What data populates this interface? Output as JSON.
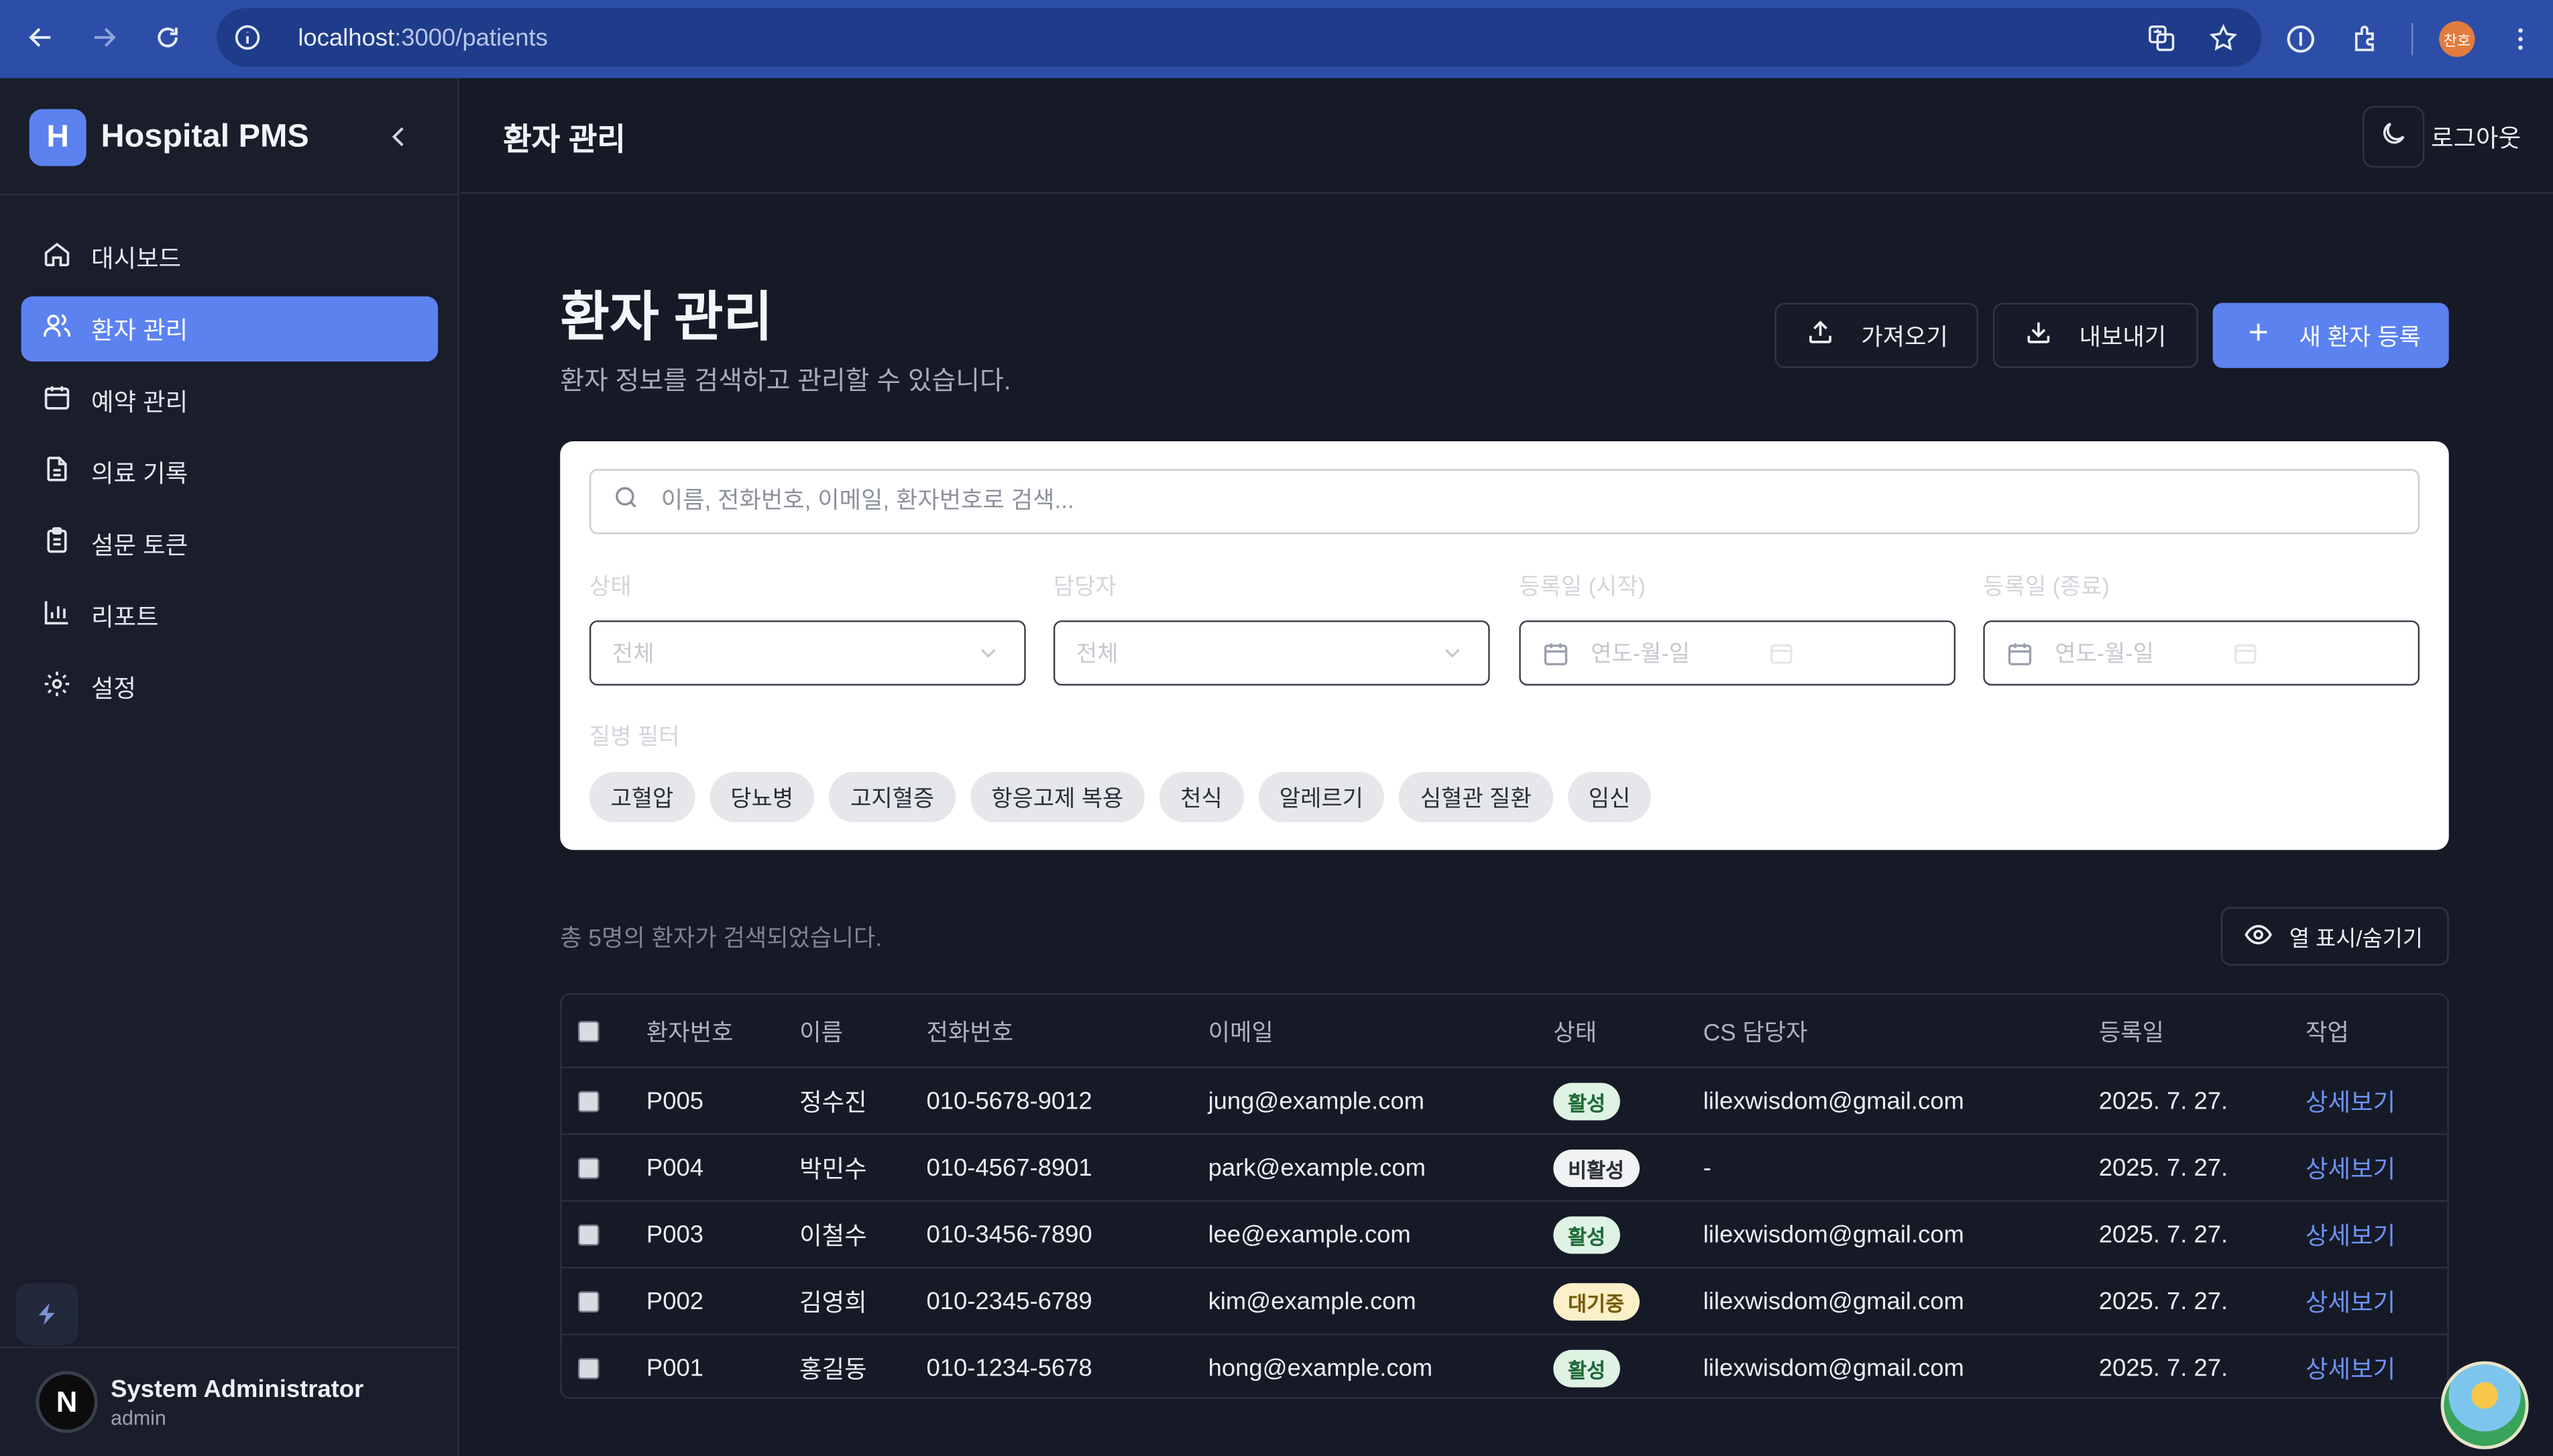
{
  "browser": {
    "url_host": "localhost",
    "url_path": ":3000/patients",
    "profile_initials": "찬호"
  },
  "sidebar": {
    "brand_letter": "H",
    "brand_name": "Hospital PMS",
    "items": [
      {
        "label": "대시보드",
        "icon": "home-icon"
      },
      {
        "label": "환자 관리",
        "icon": "users-icon",
        "active": true
      },
      {
        "label": "예약 관리",
        "icon": "calendar-icon"
      },
      {
        "label": "의료 기록",
        "icon": "file-text-icon"
      },
      {
        "label": "설문 토큰",
        "icon": "clipboard-icon"
      },
      {
        "label": "리포트",
        "icon": "bar-chart-icon"
      },
      {
        "label": "설정",
        "icon": "gear-icon"
      }
    ],
    "user": {
      "initial": "N",
      "name": "System Administrator",
      "role": "admin"
    }
  },
  "topbar": {
    "title": "환자 관리",
    "logout": "로그아웃"
  },
  "page": {
    "title": "환자 관리",
    "subtitle": "환자 정보를 검색하고 관리할 수 있습니다.",
    "import_label": "가져오기",
    "export_label": "내보내기",
    "new_label": "새 환자 등록"
  },
  "filters": {
    "search_placeholder": "이름, 전화번호, 이메일, 환자번호로 검색...",
    "status_label": "상태",
    "status_value": "전체",
    "manager_label": "담당자",
    "manager_value": "전체",
    "date_start_label": "등록일 (시작)",
    "date_end_label": "등록일 (종료)",
    "date_placeholder": "연도-월-일",
    "disease_label": "질병 필터",
    "diseases": [
      "고혈압",
      "당뇨병",
      "고지혈증",
      "항응고제 복용",
      "천식",
      "알레르기",
      "심혈관 질환",
      "임신"
    ]
  },
  "results": {
    "count_text": "총 5명의 환자가 검색되었습니다.",
    "columns_button": "열 표시/숨기기"
  },
  "table": {
    "headers": [
      "환자번호",
      "이름",
      "전화번호",
      "이메일",
      "상태",
      "CS 담당자",
      "등록일",
      "작업"
    ],
    "rows": [
      {
        "id": "P005",
        "name": "정수진",
        "phone": "010-5678-9012",
        "email": "jung@example.com",
        "status": "활성",
        "status_type": "active",
        "cs": "lilexwisdom@gmail.com",
        "date": "2025. 7. 27.",
        "action": "상세보기"
      },
      {
        "id": "P004",
        "name": "박민수",
        "phone": "010-4567-8901",
        "email": "park@example.com",
        "status": "비활성",
        "status_type": "inactive",
        "cs": "-",
        "date": "2025. 7. 27.",
        "action": "상세보기"
      },
      {
        "id": "P003",
        "name": "이철수",
        "phone": "010-3456-7890",
        "email": "lee@example.com",
        "status": "활성",
        "status_type": "active",
        "cs": "lilexwisdom@gmail.com",
        "date": "2025. 7. 27.",
        "action": "상세보기"
      },
      {
        "id": "P002",
        "name": "김영희",
        "phone": "010-2345-6789",
        "email": "kim@example.com",
        "status": "대기중",
        "status_type": "pending",
        "cs": "lilexwisdom@gmail.com",
        "date": "2025. 7. 27.",
        "action": "상세보기"
      },
      {
        "id": "P001",
        "name": "홍길동",
        "phone": "010-1234-5678",
        "email": "hong@example.com",
        "status": "활성",
        "status_type": "active",
        "cs": "lilexwisdom@gmail.com",
        "date": "2025. 7. 27.",
        "action": "상세보기"
      }
    ]
  },
  "colors": {
    "accent": "#5b82ef",
    "browser_bar": "#2c4ea8",
    "background": "#161a26",
    "sidebar": "#1a1e2b"
  }
}
